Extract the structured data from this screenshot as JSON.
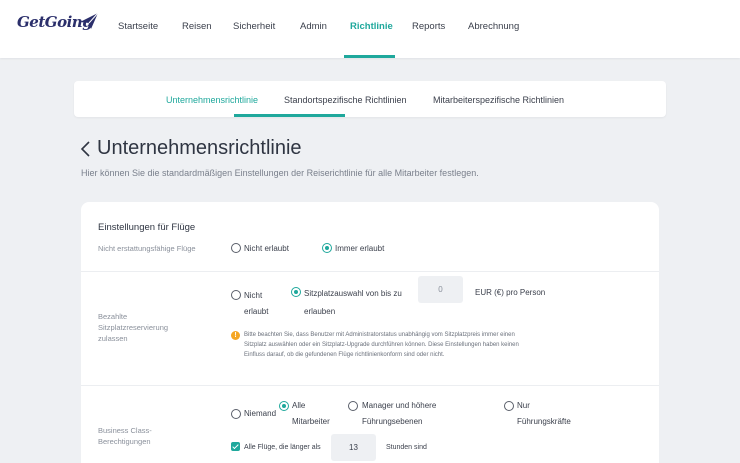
{
  "brand": {
    "logo_text": "GetGoing",
    "accent": "#1fa89c",
    "logo_color": "#2b2f6b"
  },
  "nav": {
    "items": [
      {
        "label": "Startseite"
      },
      {
        "label": "Reisen"
      },
      {
        "label": "Sicherheit"
      },
      {
        "label": "Admin"
      },
      {
        "label": "Richtlinie",
        "active": true
      },
      {
        "label": "Reports"
      },
      {
        "label": "Abrechnung"
      }
    ]
  },
  "subtabs": [
    {
      "label": "Unternehmensrichtlinie",
      "active": true
    },
    {
      "label": "Standortspezifische Richtlinien"
    },
    {
      "label": "Mitarbeiterspezifische Richtlinien"
    }
  ],
  "page": {
    "title": "Unternehmensrichtlinie",
    "subtitle": "Hier können Sie die standardmäßigen Einstellungen der Reiserichtlinie für alle Mitarbeiter festlegen."
  },
  "flights": {
    "section_title": "Einstellungen für Flüge",
    "nonrefundable": {
      "label": "Nicht erstattungsfähige Flüge",
      "options": [
        "Nicht erlaubt",
        "Immer erlaubt"
      ],
      "selected": "Immer erlaubt"
    },
    "paid_seats": {
      "label_line1": "Bezahlte",
      "label_line2": "Sitzplatzreservierung",
      "label_line3": "zulassen",
      "opt_not_line1": "Nicht",
      "opt_not_line2": "erlaubt",
      "opt_upto_line1": "Sitzplatzauswahl von bis zu",
      "opt_upto_line2": "erlauben",
      "amount_value": "0",
      "unit": "EUR (€) pro Person",
      "selected": "Sitzplatzauswahl von bis zu",
      "note_line1": "Bitte beachten Sie, dass Benutzer mit Administratorstatus unabhängig vom Sitzplatzpreis immer einen",
      "note_line2": "Sitzplatz auswählen oder ein Sitzplatz-Upgrade durchführen können. Diese Einstellungen haben keinen",
      "note_line3": "Einfluss darauf, ob die gefundenen Flüge richtlinienkonform sind oder nicht."
    },
    "business": {
      "label_line1": "Business Class-",
      "label_line2": "Berechtigungen",
      "opt_none": "Niemand",
      "opt_all_line1": "Alle",
      "opt_all_line2": "Mitarbeiter",
      "opt_mgr_line1": "Manager und höhere",
      "opt_mgr_line2": "Führungsebenen",
      "opt_only_line1": "Nur",
      "opt_only_line2": "Führungskräfte",
      "selected": "Alle Mitarbeiter",
      "longer_label": "Alle Flüge, die länger als",
      "hours_value": "13",
      "hours_suffix": "Stunden sind"
    }
  }
}
